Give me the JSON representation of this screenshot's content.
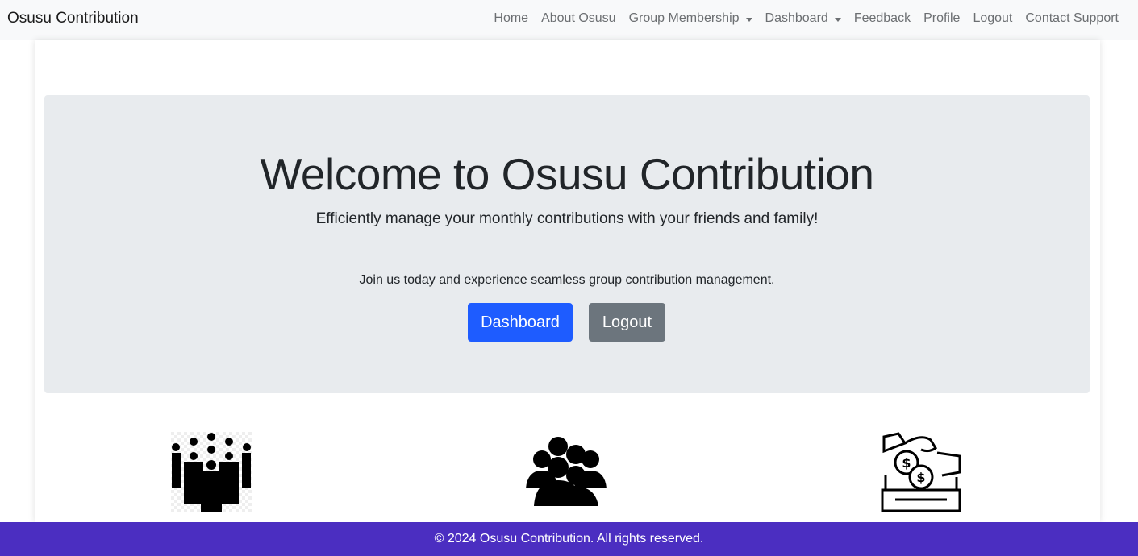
{
  "navbar": {
    "brand": "Osusu Contribution",
    "links": [
      {
        "label": "Home"
      },
      {
        "label": "About Osusu"
      },
      {
        "label": "Group Membership"
      },
      {
        "label": "Dashboard"
      },
      {
        "label": "Feedback"
      },
      {
        "label": "Profile"
      },
      {
        "label": "Logout"
      },
      {
        "label": "Contact Support"
      }
    ]
  },
  "jumbotron": {
    "title": "Welcome to Osusu Contribution",
    "lead": "Efficiently manage your monthly contributions with your friends and family!",
    "join_text": "Join us today and experience seamless group contribution management.",
    "primary_button": "Dashboard",
    "secondary_button": "Logout"
  },
  "icons": [
    "people-crowd-icon",
    "group-icon",
    "money-deposit-icon"
  ],
  "colors": {
    "primary": "#1e5cff",
    "secondary": "#6c757d",
    "footer": "#4b2ec1",
    "jumbotron_bg": "#e8ebee"
  },
  "footer": {
    "text": "© 2024 Osusu Contribution. All rights reserved."
  }
}
